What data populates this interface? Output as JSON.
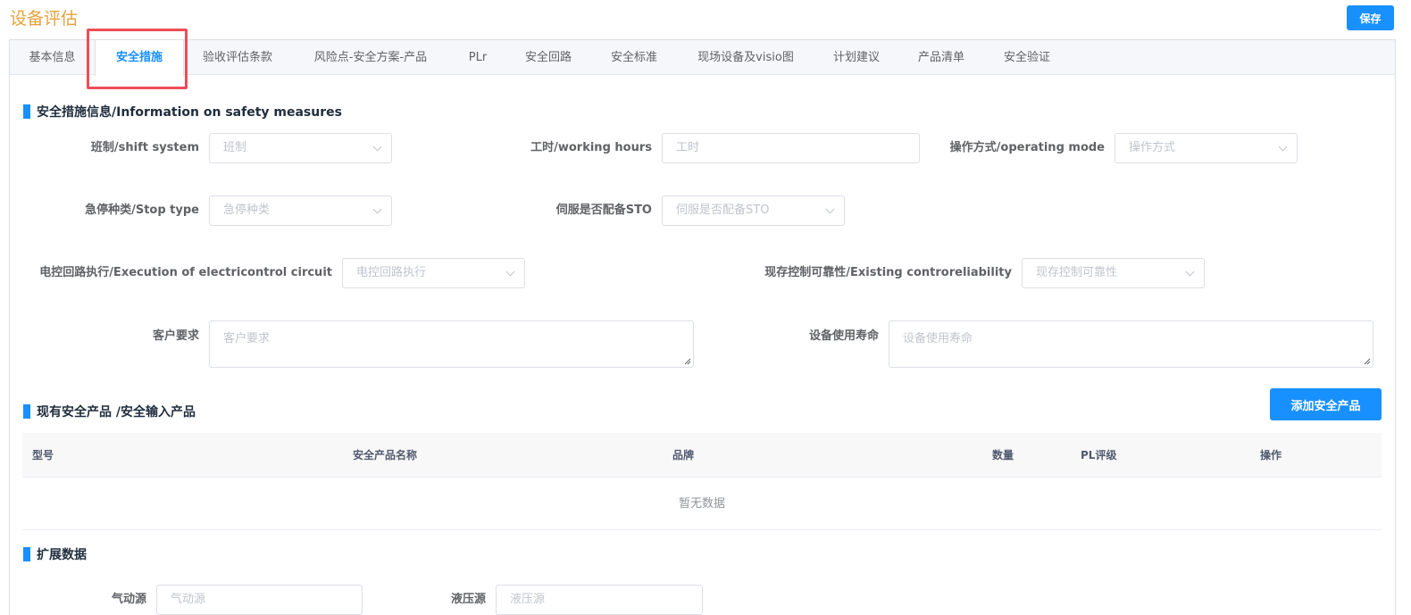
{
  "page": {
    "title": "设备评估",
    "save_label": "保存"
  },
  "tabs": [
    {
      "label": "基本信息"
    },
    {
      "label": "安全措施",
      "active": true
    },
    {
      "label": "验收评估条款"
    },
    {
      "label": "风险点-安全方案-产品"
    },
    {
      "label": "PLr"
    },
    {
      "label": "安全回路"
    },
    {
      "label": "安全标准"
    },
    {
      "label": "现场设备及visio图"
    },
    {
      "label": "计划建议"
    },
    {
      "label": "产品清单"
    },
    {
      "label": "安全验证"
    }
  ],
  "safety_info": {
    "title": "安全措施信息/Information on safety measures",
    "shift": {
      "label": "班制/shift system",
      "placeholder": "班制"
    },
    "hours": {
      "label": "工时/working hours",
      "placeholder": "工时"
    },
    "mode": {
      "label": "操作方式/operating mode",
      "placeholder": "操作方式"
    },
    "stop": {
      "label": "急停种类/Stop type",
      "placeholder": "急停种类"
    },
    "sto": {
      "label": "伺服是否配备STO",
      "placeholder": "伺服是否配备STO"
    },
    "circuit": {
      "label": "电控回路执行/Execution of electricontrol circuit",
      "placeholder": "电控回路执行"
    },
    "reliability": {
      "label": "现存控制可靠性/Existing controreliability",
      "placeholder": "现存控制可靠性"
    },
    "customer": {
      "label": "客户要求",
      "placeholder": "客户要求"
    },
    "lifespan": {
      "label": "设备使用寿命",
      "placeholder": "设备使用寿命"
    }
  },
  "products": {
    "title": "现有安全产品 /安全输入产品",
    "add_label": "添加安全产品",
    "columns": [
      "型号",
      "安全产品名称",
      "品牌",
      "数量",
      "PL评级",
      "操作"
    ],
    "empty_text": "暂无数据"
  },
  "extended": {
    "title": "扩展数据",
    "pneumatic": {
      "label": "气动源",
      "placeholder": "气动源"
    },
    "hydraulic": {
      "label": "液压源",
      "placeholder": "液压源"
    }
  }
}
